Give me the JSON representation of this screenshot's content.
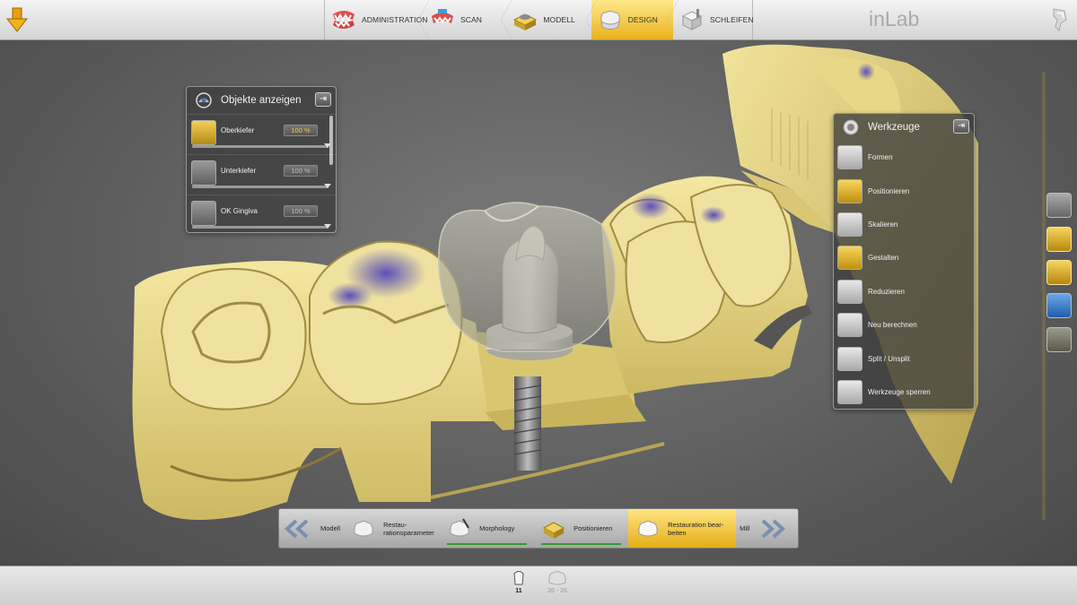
{
  "app": {
    "brand": "inLab"
  },
  "phases": [
    {
      "label": "ADMINISTRATION",
      "icon": "administration-teeth-icon",
      "active": false
    },
    {
      "label": "SCAN",
      "icon": "scan-jaw-icon",
      "active": false
    },
    {
      "label": "MODELL",
      "icon": "model-icon",
      "active": false
    },
    {
      "label": "DESIGN",
      "icon": "design-crown-icon",
      "active": true
    },
    {
      "label": "SCHLEIFEN",
      "icon": "milling-block-icon",
      "active": false
    }
  ],
  "objects_panel": {
    "title": "Objekte anzeigen",
    "items": [
      {
        "label": "Oberkiefer",
        "value": "100 %",
        "on": true,
        "icon": "upper-jaw-icon"
      },
      {
        "label": "Unterkiefer",
        "value": "100 %",
        "on": false,
        "icon": "lower-jaw-icon"
      },
      {
        "label": "OK Gingiva",
        "value": "100 %",
        "on": false,
        "icon": "gingiva-icon"
      }
    ]
  },
  "tools_panel": {
    "title": "Werkzeuge",
    "items": [
      {
        "label": "Formen",
        "icon": "shape-icon"
      },
      {
        "label": "Positionieren",
        "icon": "position-icon"
      },
      {
        "label": "Skalieren",
        "icon": "scale-icon"
      },
      {
        "label": "Gestalten",
        "icon": "design-tool-icon"
      },
      {
        "label": "Reduzieren",
        "icon": "reduce-icon"
      },
      {
        "label": "Neu berechnen",
        "icon": "recalculate-icon"
      },
      {
        "label": "Split / Unsplit",
        "icon": "split-icon"
      },
      {
        "label": "Werkzeuge sperren",
        "icon": "lock-icon"
      }
    ]
  },
  "stepbar": {
    "prev_label": "Modell",
    "next_label": "Mill",
    "steps": [
      {
        "label": "Restau-\nrationsparameter",
        "done": false,
        "active": false,
        "icon": "restoration-parameters-icon"
      },
      {
        "label": "Morphology",
        "done": true,
        "active": false,
        "icon": "morphology-icon"
      },
      {
        "label": "Positionieren",
        "done": true,
        "active": false,
        "icon": "positioning-icon"
      },
      {
        "label": "Restauration bear-\nbeiten",
        "done": false,
        "active": true,
        "icon": "edit-restoration-icon"
      }
    ]
  },
  "bottombar": {
    "restorations": [
      {
        "label": "11",
        "active": true
      },
      {
        "label": "26 - 26",
        "active": false
      }
    ]
  },
  "colors": {
    "accent": "#e9b21c",
    "model": "#e8d98a",
    "panel": "#3c3c3c"
  }
}
